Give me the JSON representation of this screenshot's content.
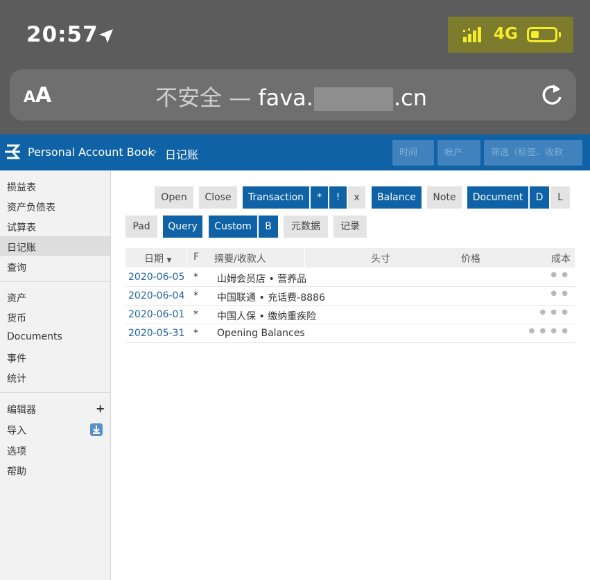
{
  "status_bar": {
    "time": "20:57",
    "network": "4G",
    "location_icon": "location-arrow-icon",
    "signal_icon": "signal-bars-icon",
    "battery_icon": "battery-icon"
  },
  "browser": {
    "text_size_label_small": "A",
    "text_size_label_big": "A",
    "insecure_label": "不安全 —",
    "url_prefix": "fava.",
    "url_suffix": ".cn",
    "reload_icon": "reload-icon"
  },
  "header": {
    "brand": "Personal Account Book",
    "separator": "›",
    "current_page": "日记账",
    "time_filter_placeholder": "时间",
    "account_filter_placeholder": "帐户",
    "filter_placeholder": "筛选（标签、收款"
  },
  "sidebar": {
    "group1": [
      "损益表",
      "资产负债表",
      "试算表",
      "日记账",
      "查询"
    ],
    "group2": [
      "资产",
      "货币",
      "Documents",
      "事件",
      "统计"
    ],
    "group3": [
      "编辑器",
      "导入",
      "选项",
      "帮助"
    ],
    "active": "日记账",
    "editor_add": "+"
  },
  "filters": {
    "row1": [
      {
        "label": "Open",
        "active": false
      },
      {
        "label": "Close",
        "active": false
      },
      {
        "label": "Transaction",
        "active": true
      },
      {
        "label": "*",
        "active": true
      },
      {
        "label": "!",
        "active": true
      },
      {
        "label": "x",
        "active": false
      },
      {
        "label": "Balance",
        "active": true
      },
      {
        "label": "Note",
        "active": false
      },
      {
        "label": "Document",
        "active": true
      },
      {
        "label": "D",
        "active": true
      },
      {
        "label": "L",
        "active": false
      }
    ],
    "row2": [
      {
        "label": "Pad",
        "active": false
      },
      {
        "label": "Query",
        "active": true
      },
      {
        "label": "Custom",
        "active": true
      },
      {
        "label": "B",
        "active": true
      },
      {
        "label": "元数据",
        "active": false
      },
      {
        "label": "记录",
        "active": false
      }
    ]
  },
  "journal": {
    "columns": [
      "日期",
      "F",
      "摘要/收款人",
      "头寸",
      "价格",
      "成本"
    ],
    "sort_indicator": "▼",
    "rows": [
      {
        "date": "2020-06-05",
        "flag": "*",
        "payee": "山姆会员店",
        "narration": "营养品",
        "dots": "● ●"
      },
      {
        "date": "2020-06-04",
        "flag": "*",
        "payee": "中国联通",
        "narration": "充话费-8886",
        "dots": "● ●"
      },
      {
        "date": "2020-06-01",
        "flag": "*",
        "payee": "中国人保",
        "narration": "缴纳重疾险",
        "dots": "● ● ●"
      },
      {
        "date": "2020-05-31",
        "flag": "*",
        "payee": "",
        "narration": "Opening Balances",
        "dots": "● ● ● ●"
      }
    ],
    "bullet": "•"
  },
  "colors": {
    "accent": "#0f62a6",
    "status_highlight": "#f4ec2c"
  }
}
